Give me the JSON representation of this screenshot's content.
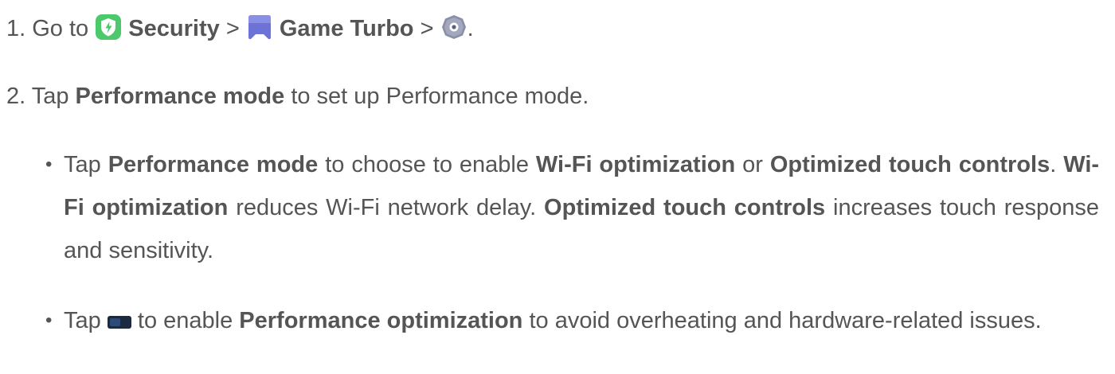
{
  "step1": {
    "prefix": "1. Go to",
    "security": "Security",
    "sep1": ">",
    "game_turbo": "Game Turbo",
    "sep2": ">",
    "suffix": "."
  },
  "step2": {
    "prefix": "2. Tap",
    "bold": "Performance mode",
    "suffix": "to set up Performance mode."
  },
  "bullet1": {
    "dot": "•",
    "t1": "Tap",
    "b1": "Performance mode",
    "t2": "to choose to enable",
    "b2": "Wi-Fi optimization",
    "t3": "or",
    "b3": "Optimized touch controls",
    "t4": ".",
    "b4": "Wi-Fi optimization",
    "t5": "reduces Wi-Fi network delay.",
    "b5": "Optimized touch controls",
    "t6": "increases touch response and sensitivity."
  },
  "bullet2": {
    "dot": "•",
    "t1": "Tap",
    "t2": "to enable",
    "b1": "Performance optimization",
    "t3": "to avoid overheating and hardware-related issues."
  },
  "icons": {
    "security": "security-shield-icon",
    "game_turbo": "game-turbo-icon",
    "settings": "settings-gear-icon",
    "toggle": "toggle-switch-icon"
  },
  "colors": {
    "text": "#555555",
    "security_green": "#4CC96B",
    "game_turbo_purple": "#6C72D6",
    "gear_gray": "#8A8FA8",
    "toggle_dark": "#1C2A40"
  }
}
